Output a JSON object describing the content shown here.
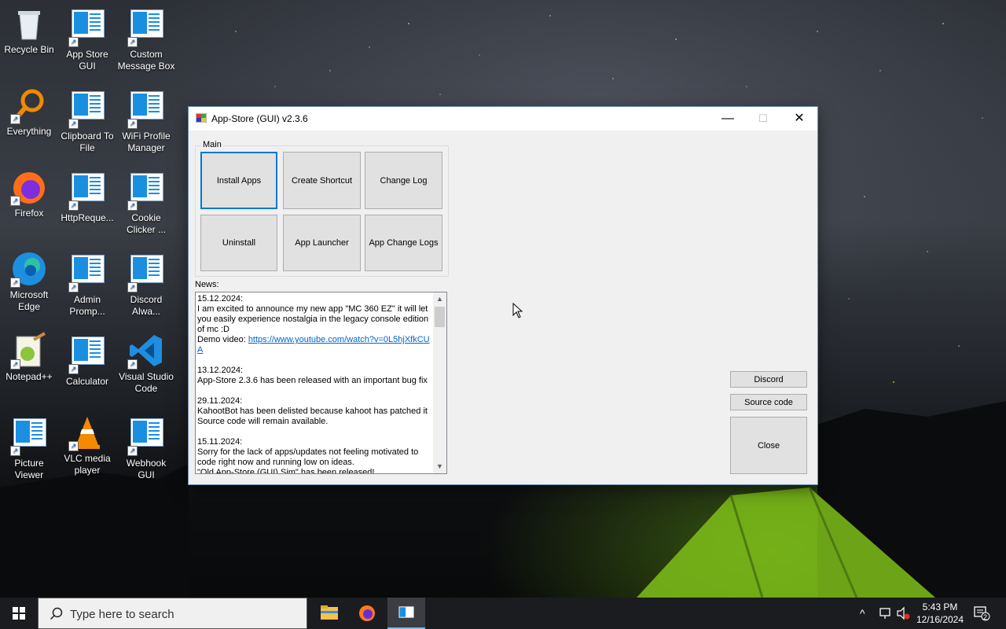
{
  "desktop": {
    "icons": [
      {
        "label": "Recycle Bin",
        "icon": "recycle-bin-icon"
      },
      {
        "label": "App Store\nGUI",
        "icon": "app-window-icon"
      },
      {
        "label": "Custom\nMessage Box",
        "icon": "app-window-icon"
      },
      {
        "label": "Everything",
        "icon": "everything-icon"
      },
      {
        "label": "Clipboard To\nFile",
        "icon": "app-window-icon"
      },
      {
        "label": "WiFi Profile\nManager",
        "icon": "app-window-icon"
      },
      {
        "label": "Firefox",
        "icon": "firefox-icon"
      },
      {
        "label": "HttpReque...",
        "icon": "app-window-icon"
      },
      {
        "label": "Cookie\nClicker ...",
        "icon": "app-window-icon"
      },
      {
        "label": "Microsoft\nEdge",
        "icon": "edge-icon"
      },
      {
        "label": "Admin\nPromp...",
        "icon": "app-window-icon"
      },
      {
        "label": "Discord\nAlwa...",
        "icon": "app-window-icon"
      },
      {
        "label": "Notepad++",
        "icon": "notepadpp-icon"
      },
      {
        "label": "Calculator",
        "icon": "app-window-icon"
      },
      {
        "label": "Visual Studio\nCode",
        "icon": "vscode-icon"
      },
      {
        "label": "Picture\nViewer",
        "icon": "app-window-icon"
      },
      {
        "label": "VLC media\nplayer",
        "icon": "vlc-icon"
      },
      {
        "label": "Webhook\nGUI",
        "icon": "app-window-icon"
      }
    ]
  },
  "window": {
    "title": "App-Store (GUI) v2.3.6",
    "controls": {
      "minimize": "—",
      "maximize": "☐",
      "close": "✕"
    },
    "main_group_label": "Main",
    "buttons": {
      "install_apps": "Install Apps",
      "create_shortcut": "Create Shortcut",
      "change_log": "Change Log",
      "uninstall": "Uninstall",
      "app_launcher": "App Launcher",
      "app_change_logs": "App Change Logs",
      "discord": "Discord",
      "source_code": "Source code",
      "close": "Close"
    },
    "news_label": "News:",
    "news": {
      "item1_date": "15.12.2024:",
      "item1_text": "I am excited to announce my new app \"MC 360 EZ\" it will let you easily experience nostalgia in the legacy console edition of mc :D",
      "item1_demo_prefix": "Demo video: ",
      "item1_link": "https://www.youtube.com/watch?v=0L5hjXfkCUA",
      "item2_date": "13.12.2024:",
      "item2_text": "App-Store 2.3.6 has been released with an important bug fix",
      "item3_date": "29.11.2024:",
      "item3_text1": "KahootBot has been delisted because kahoot has patched it",
      "item3_text2": "Source code will remain available.",
      "item4_date": "15.11.2024:",
      "item4_text": "Sorry for the lack of apps/updates not feeling motivated to code right now and running low on ideas.",
      "item4_text2": "\"Old App-Store (GUI) Sim\" has been released!"
    }
  },
  "taskbar": {
    "search_placeholder": "Type here to search",
    "time": "5:43 PM",
    "date": "12/16/2024",
    "notification_count": "2"
  }
}
